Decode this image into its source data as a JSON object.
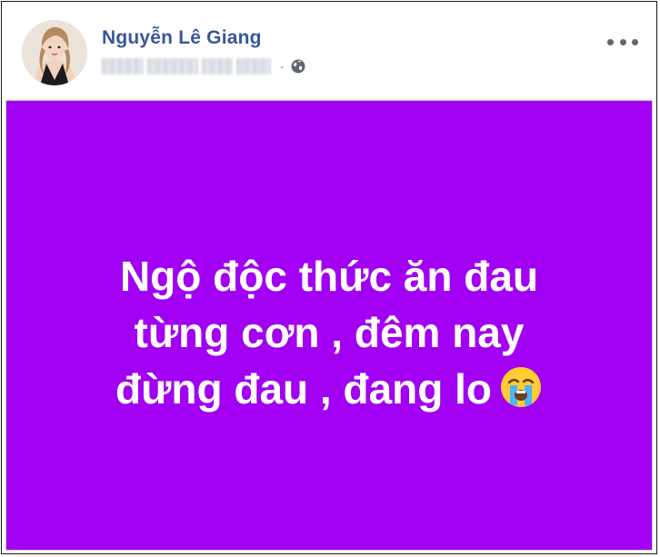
{
  "post": {
    "author_name": "Nguyễn Lê Giang",
    "privacy_icon": "globe-icon",
    "more_icon": "more-options-icon",
    "status_lines": [
      "Ngộ độc thức ăn đau",
      "từng cơn , đêm nay",
      "đừng đau , đang lo"
    ],
    "status_emoji": "loudly-crying-face-icon",
    "card_color": "#a100f2",
    "name_color": "#385898"
  }
}
